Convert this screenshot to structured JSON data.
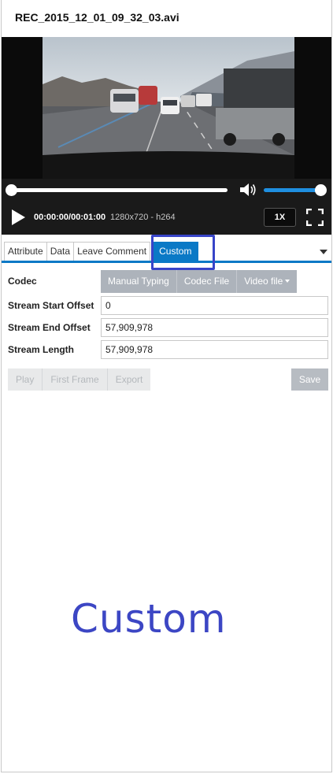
{
  "file": {
    "title": "REC_2015_12_01_09_32_03.avi"
  },
  "player": {
    "progress": 0,
    "volume": 1.0,
    "timecode": "00:00:00/00:01:00",
    "resolution": "1280x720 - h264",
    "speed_label": "1X"
  },
  "tabs": [
    {
      "label": "Attribute",
      "active": false
    },
    {
      "label": "Data",
      "active": false
    },
    {
      "label": "Leave Comment",
      "active": false
    },
    {
      "label": "Custom",
      "active": true
    }
  ],
  "form": {
    "codec_label": "Codec",
    "codec_buttons": [
      "Manual Typing",
      "Codec File",
      "Video file"
    ],
    "start_offset_label": "Stream Start Offset",
    "start_offset_value": "0",
    "end_offset_label": "Stream End Offset",
    "end_offset_value": "57,909,978",
    "length_label": "Stream Length",
    "length_value": "57,909,978"
  },
  "actions": {
    "play": "Play",
    "first_frame": "First Frame",
    "export": "Export",
    "save": "Save"
  },
  "annotation": {
    "label": "Custom"
  },
  "colors": {
    "accent": "#0a79c6",
    "highlight": "#3844c8",
    "button": "#adb3bb"
  }
}
